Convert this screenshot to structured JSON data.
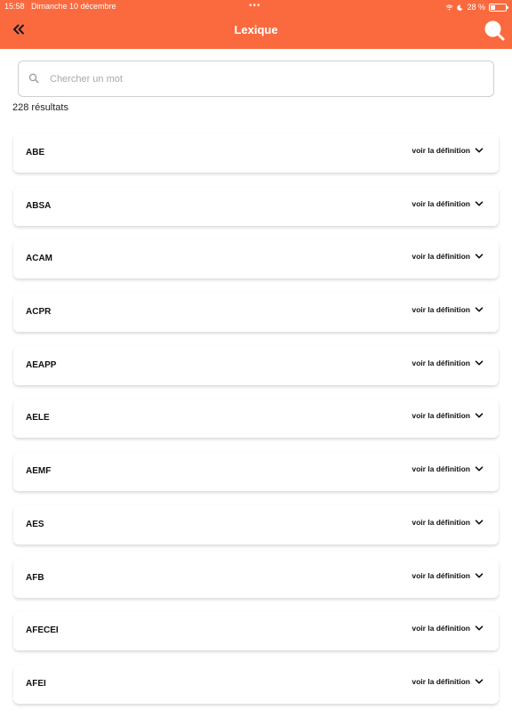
{
  "status_bar": {
    "time": "15:58",
    "date": "Dimanche 10 décembre",
    "battery": "28 %"
  },
  "header": {
    "title": "Lexique",
    "back_icon": "double-chevron-left-icon",
    "search_icon": "search-icon",
    "background": "#fb6a3e"
  },
  "search": {
    "placeholder": "Chercher un mot",
    "value": ""
  },
  "results": {
    "count_label": "228 résultats"
  },
  "toggle_label": "voir la définition",
  "items": [
    {
      "term": "ABE",
      "toggle": "voir la définition"
    },
    {
      "term": "ABSA",
      "toggle": "voir la définition"
    },
    {
      "term": "ACAM",
      "toggle": "voir la définition"
    },
    {
      "term": "ACPR",
      "toggle": "voir la définition"
    },
    {
      "term": "AEAPP",
      "toggle": "voir la définition"
    },
    {
      "term": "AELE",
      "toggle": "voir la définition"
    },
    {
      "term": "AEMF",
      "toggle": "voir la définition"
    },
    {
      "term": "AES",
      "toggle": "voir la définition"
    },
    {
      "term": "AFB",
      "toggle": "voir la définition"
    },
    {
      "term": "AFECEI",
      "toggle": "voir la définition"
    },
    {
      "term": "AFEI",
      "toggle": "voir la définition"
    }
  ]
}
